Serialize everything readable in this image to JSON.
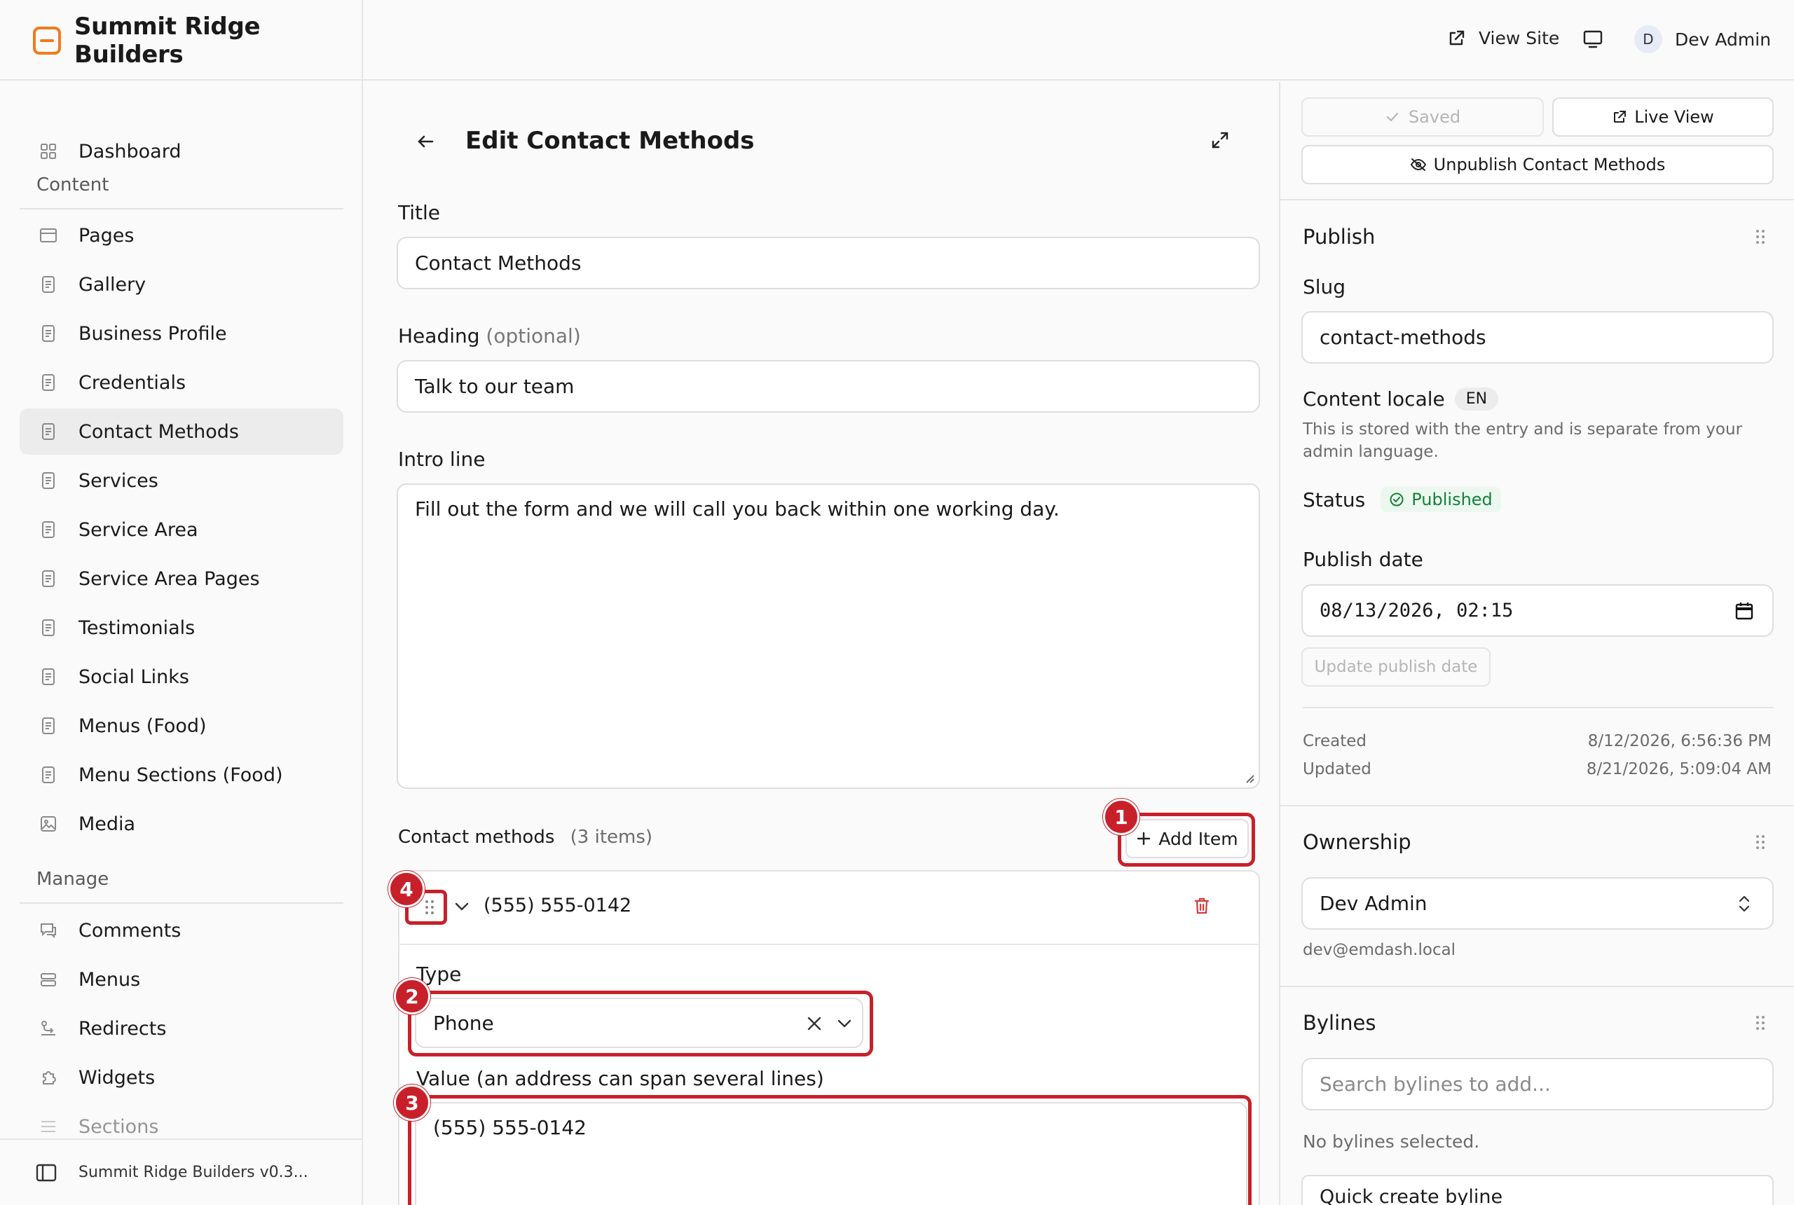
{
  "app": {
    "brand": "Summit Ridge Builders",
    "view_site": "View Site",
    "user_initial": "D",
    "user_name": "Dev Admin",
    "accent_color": "#f07b1d",
    "highlight_color": "#c8202a"
  },
  "sidebar": {
    "dashboard": "Dashboard",
    "content_heading": "Content",
    "content_items": [
      "Pages",
      "Gallery",
      "Business Profile",
      "Credentials",
      "Contact Methods",
      "Services",
      "Service Area",
      "Service Area Pages",
      "Testimonials",
      "Social Links",
      "Menus (Food)",
      "Menu Sections (Food)",
      "Media"
    ],
    "active_item": "Contact Methods",
    "manage_heading": "Manage",
    "manage_items": [
      "Comments",
      "Menus",
      "Redirects",
      "Widgets",
      "Sections"
    ],
    "footer": "Summit Ridge Builders v0.3..."
  },
  "editor": {
    "title": "Edit Contact Methods",
    "title_label": "Title",
    "title_value": "Contact Methods",
    "heading_label": "Heading",
    "heading_optional": "(optional)",
    "heading_value": "Talk to our team",
    "intro_label": "Intro line",
    "intro_value": "Fill out the form and we will call you back within one working day.",
    "repeater_label": "Contact methods",
    "repeater_count": "(3 items)",
    "add_item": "Add Item",
    "item_title": "(555) 555-0142",
    "type_label": "Type",
    "type_value": "Phone",
    "value_label": "Value (an address can span several lines)",
    "value_value": "(555) 555-0142",
    "annotations": [
      "1",
      "2",
      "3",
      "4"
    ]
  },
  "panel": {
    "saved": "Saved",
    "live_view": "Live View",
    "unpublish": "Unpublish Contact Methods",
    "publish_title": "Publish",
    "slug_label": "Slug",
    "slug_value": "contact-methods",
    "locale_label": "Content locale",
    "locale_value": "EN",
    "locale_help": "This is stored with the entry and is separate from your admin language.",
    "status_label": "Status",
    "status_value": "Published",
    "status_color": "#15803d",
    "publish_date_label": "Publish date",
    "publish_date_value": "08/13/2026, 02:15",
    "update_publish_date": "Update publish date",
    "created_label": "Created",
    "created_value": "8/12/2026, 6:56:36 PM",
    "updated_label": "Updated",
    "updated_value": "8/21/2026, 5:09:04 AM",
    "ownership_title": "Ownership",
    "owner_value": "Dev Admin",
    "owner_email": "dev@emdash.local",
    "bylines_title": "Bylines",
    "bylines_placeholder": "Search bylines to add...",
    "no_bylines": "No bylines selected.",
    "quick_create": "Quick create byline"
  }
}
